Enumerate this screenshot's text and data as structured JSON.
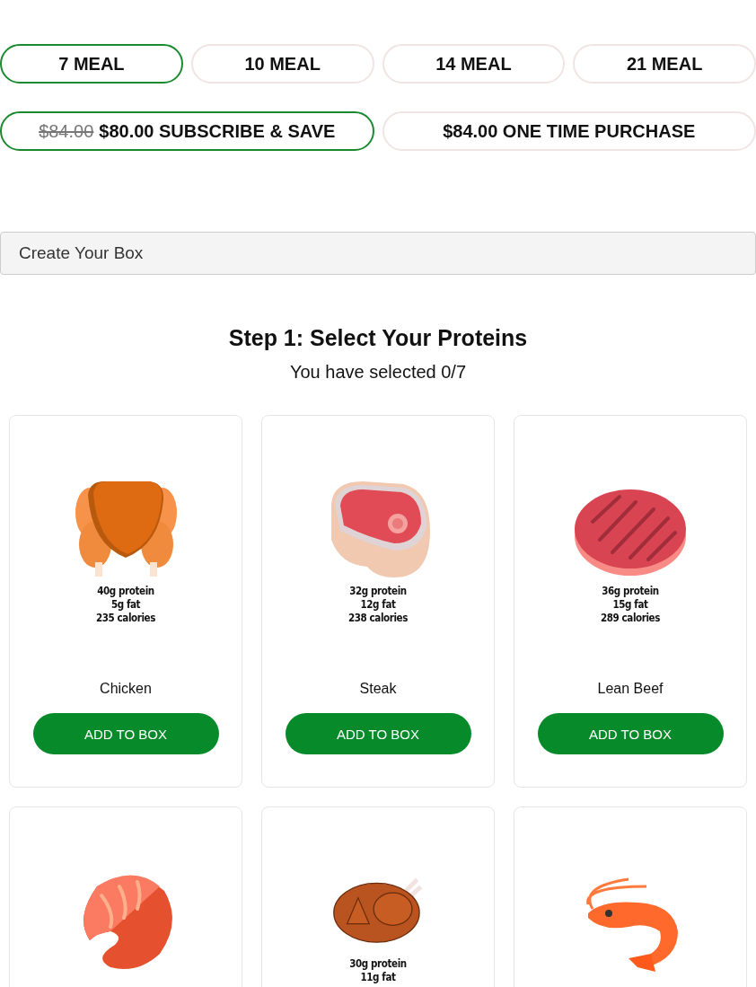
{
  "meal_options": [
    {
      "label": "7 MEAL",
      "selected": true
    },
    {
      "label": "10 MEAL",
      "selected": false
    },
    {
      "label": "14 MEAL",
      "selected": false
    },
    {
      "label": "21 MEAL",
      "selected": false
    }
  ],
  "purchase_options": [
    {
      "old_price": "$84.00",
      "label": "$80.00 SUBSCRIBE & SAVE",
      "selected": true
    },
    {
      "label": "$84.00 ONE TIME PURCHASE",
      "selected": false
    }
  ],
  "box_bar": {
    "title": "Create Your Box"
  },
  "step": {
    "title": "Step 1: Select Your Proteins",
    "selected_count": "You have selected 0/7"
  },
  "products": [
    {
      "kind": "chicken",
      "nutrition": [
        "40g protein",
        "5g fat",
        "235 calories"
      ],
      "name": "Chicken",
      "button": "ADD TO BOX"
    },
    {
      "kind": "steak",
      "nutrition": [
        "32g protein",
        "12g fat",
        "238 calories"
      ],
      "name": "Steak",
      "button": "ADD TO BOX"
    },
    {
      "kind": "beef",
      "nutrition": [
        "36g protein",
        "15g fat",
        "289 calories"
      ],
      "name": "Lean Beef",
      "button": "ADD TO BOX"
    },
    {
      "kind": "salmon"
    },
    {
      "kind": "turkey",
      "nutrition": [
        "30g protein",
        "11g fat"
      ]
    },
    {
      "kind": "shrimp"
    }
  ]
}
